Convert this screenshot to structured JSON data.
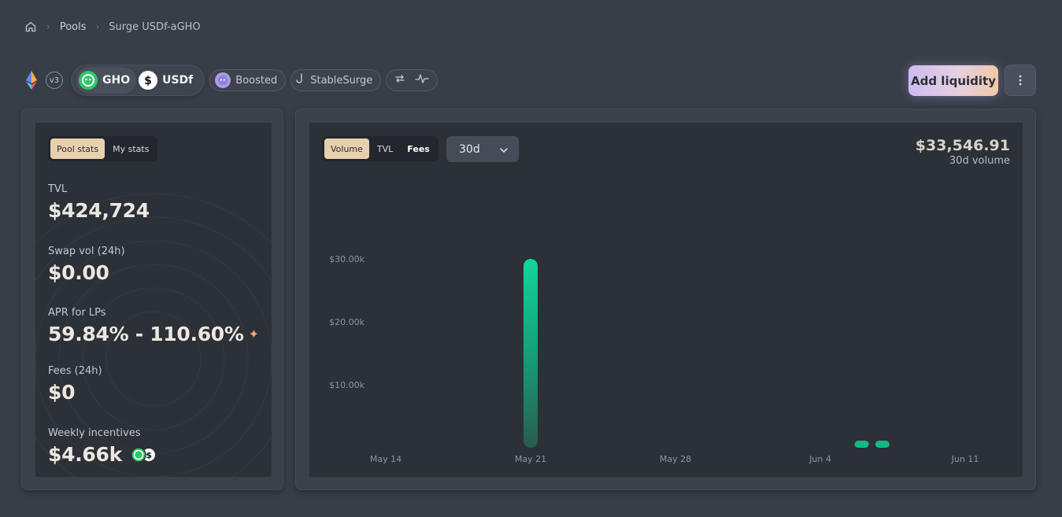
{
  "breadcrumb": {
    "home_icon": "home-icon",
    "pools": "Pools",
    "current": "Surge USDf-aGHO"
  },
  "pool_header": {
    "network_icon": "ethereum-icon",
    "version": "v3",
    "tokens": [
      {
        "symbol": "GHO",
        "icon": "gho-icon",
        "color": "#2fc76b"
      },
      {
        "symbol": "USDf",
        "icon": "usdf-icon",
        "color": "#ffffff"
      }
    ],
    "tags": [
      {
        "label": "Boosted",
        "icon": "boosted-icon"
      },
      {
        "label": "StableSurge",
        "icon": "hook-icon"
      }
    ],
    "swap_icons": [
      "swap-arrows-icon",
      "pulse-icon"
    ],
    "add_liquidity": "Add liquidity",
    "more_icon": "more-vertical-icon"
  },
  "stats": {
    "tabs": [
      {
        "label": "Pool stats",
        "active": true
      },
      {
        "label": "My stats",
        "active": false
      }
    ],
    "items": [
      {
        "label": "TVL",
        "value": "$424,724"
      },
      {
        "label": "Swap vol (24h)",
        "value": "$0.00"
      },
      {
        "label": "APR for LPs",
        "value": "59.84% - 110.60%"
      },
      {
        "label": "Fees (24h)",
        "value": "$0"
      },
      {
        "label": "Weekly incentives",
        "value": "$4.66k"
      }
    ]
  },
  "chart_panel": {
    "tabs": [
      {
        "label": "Volume",
        "active": true
      },
      {
        "label": "TVL",
        "active": false
      },
      {
        "label": "Fees",
        "active": false
      }
    ],
    "period": "30d",
    "total_value": "$33,546.91",
    "total_label": "30d volume",
    "accent": "#10c98f"
  },
  "chart_data": {
    "type": "bar",
    "x_ticks": [
      "May 14",
      "May 21",
      "May 28",
      "Jun 4",
      "Jun 11"
    ],
    "y_ticks": [
      "$10.00k",
      "$20.00k",
      "$30.00k"
    ],
    "ylim": [
      0,
      40000
    ],
    "bars": [
      {
        "date": "May 21",
        "value": 30000
      },
      {
        "date": "Jun 6",
        "value": 150
      },
      {
        "date": "Jun 7",
        "value": 500
      }
    ],
    "grid": false,
    "title": "",
    "xlabel": "",
    "ylabel": ""
  }
}
